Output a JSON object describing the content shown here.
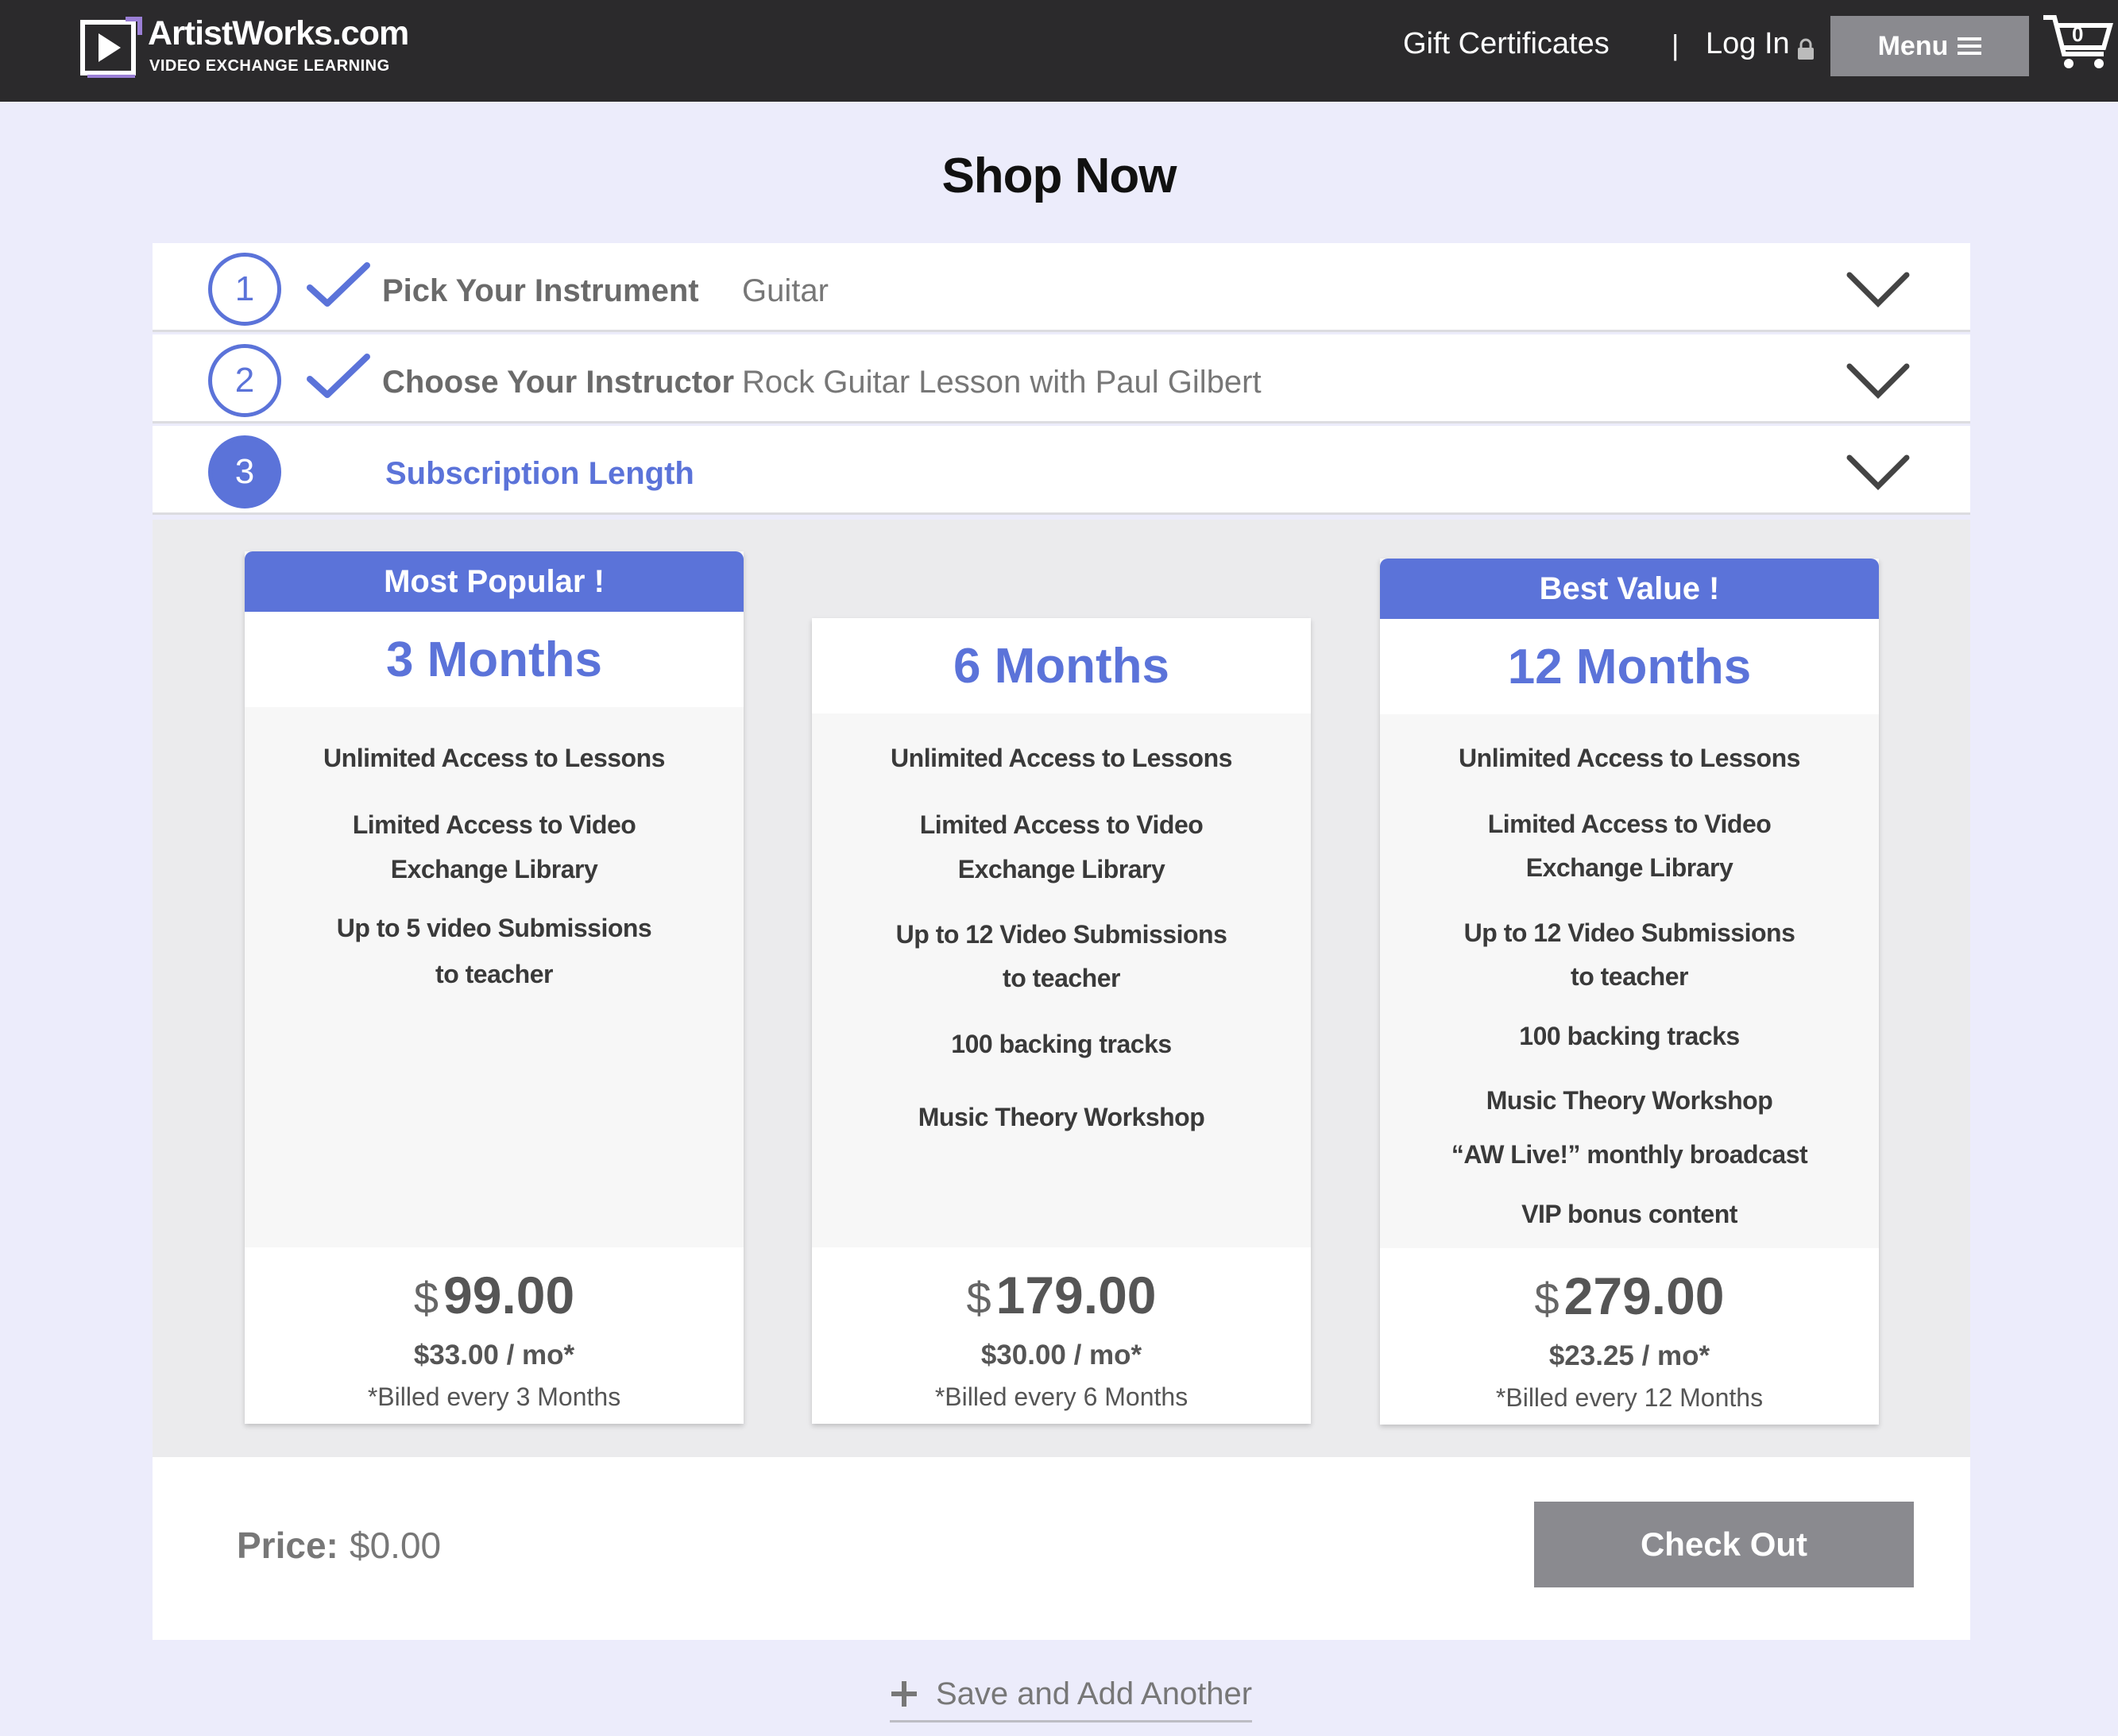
{
  "header": {
    "logo_title": "ArtistWorks.com",
    "logo_subtitle": "VIDEO EXCHANGE LEARNING",
    "gift_certificates": "Gift Certificates",
    "separator": "|",
    "login": "Log In",
    "menu": "Menu",
    "cart_count": "0"
  },
  "page": {
    "title": "Shop Now"
  },
  "steps": [
    {
      "number": "1",
      "label": "Pick Your Instrument",
      "value": "Guitar"
    },
    {
      "number": "2",
      "label": "Choose Your Instructor",
      "value": "Rock Guitar Lesson with Paul Gilbert"
    },
    {
      "number": "3",
      "label": "Subscription Length",
      "value": ""
    }
  ],
  "plans": [
    {
      "badge": "Most Popular !",
      "duration": "3 Months",
      "features": [
        "Unlimited Access to Lessons",
        "Limited Access to Video",
        "Exchange Library",
        "Up to 5 video Submissions",
        "to teacher"
      ],
      "currency": "$",
      "price": "99.00",
      "monthly": "$33.00 / mo*",
      "billed": "*Billed every 3 Months"
    },
    {
      "badge": "",
      "duration": "6 Months",
      "features": [
        "Unlimited Access to Lessons",
        "Limited Access to Video",
        "Exchange Library",
        "Up to 12 Video Submissions",
        "to teacher",
        "100 backing tracks",
        "Music Theory Workshop"
      ],
      "currency": "$",
      "price": "179.00",
      "monthly": "$30.00 / mo*",
      "billed": "*Billed every 6 Months"
    },
    {
      "badge": "Best Value !",
      "duration": "12 Months",
      "features": [
        "Unlimited Access to Lessons",
        "Limited Access to Video",
        "Exchange Library",
        "Up to 12 Video Submissions",
        "to teacher",
        "100 backing tracks",
        "Music Theory Workshop",
        "“AW Live!” monthly broadcast",
        "VIP bonus content"
      ],
      "currency": "$",
      "price": "279.00",
      "monthly": "$23.25 / mo*",
      "billed": "*Billed every 12 Months"
    }
  ],
  "checkout": {
    "price_label": "Price:",
    "price_value": "$0.00",
    "button": "Check Out",
    "save_add": "Save and Add Another"
  },
  "colors": {
    "accent": "#5b73d9",
    "header_bg": "#2b2a2c",
    "page_bg": "#ececfb",
    "button_gray": "#8a8a8f"
  }
}
